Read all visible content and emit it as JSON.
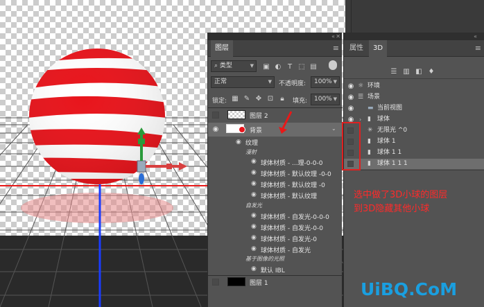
{
  "layers_panel": {
    "tab_label": "图层",
    "filter_value": "类型",
    "blend_mode": "正常",
    "opacity_label": "不透明度:",
    "opacity_value": "100%",
    "lock_label": "锁定:",
    "fill_label": "填充:",
    "fill_value": "100%",
    "layers": [
      {
        "name": "图层 2"
      },
      {
        "name": "背景"
      },
      {
        "name": "图层 1"
      }
    ],
    "texture_label": "纹理",
    "diffuse_label": "漫射",
    "diffuse_items": [
      "球体材质 - ...理-0-0-0",
      "球体材质 - 默认纹理 -0-0",
      "球体材质 - 默认纹理 -0",
      "球体材质 - 默认纹理"
    ],
    "emissive_label": "自发光",
    "emissive_items": [
      "球体材质 - 自发光-0-0-0",
      "球体材质 - 自发光-0-0",
      "球体材质 - 自发光-0",
      "球体材质 - 自发光"
    ],
    "ibl_label": "基于图像的光照",
    "ibl_item": "默认 IBL"
  },
  "panel_3d": {
    "tab_properties": "属性",
    "tab_3d": "3D",
    "items": [
      {
        "name": "环境",
        "icon": "environment-icon"
      },
      {
        "name": "场景",
        "icon": "scene-icon"
      },
      {
        "name": "当前视图",
        "icon": "camera-icon"
      },
      {
        "name": "球体",
        "icon": "mesh-icon"
      },
      {
        "name": "无限光 ^0",
        "icon": "light-icon"
      },
      {
        "name": "球体 1",
        "icon": "mesh-icon"
      },
      {
        "name": "球体 1 1",
        "icon": "mesh-icon"
      },
      {
        "name": "球体 1 1 1",
        "icon": "mesh-icon"
      }
    ]
  },
  "annotation": {
    "line1": "选中做了3D小球的图层",
    "line2": "到3D隐藏其他小球"
  },
  "watermark": "UiBQ.CoM",
  "colors": {
    "stripe_red": "#e8141b",
    "annotation_red": "#ff2a2a",
    "axis_blue": "#1a3cff",
    "watermark_blue": "#1a9fe0"
  }
}
